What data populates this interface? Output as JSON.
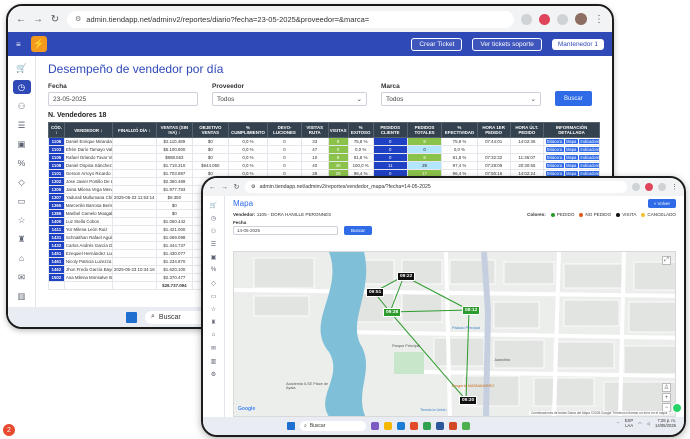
{
  "window1": {
    "url": "admin.tiendapp.net/adminv2/reportes/diario?fecha=23-05-2025&proveedor=&marca=",
    "top_buttons": {
      "ticket": "Crear Ticket",
      "support": "Ver tickets soporte",
      "user": "Mantenedor 1"
    },
    "title": "Desempeño de vendedor por día",
    "filters": {
      "fecha_label": "Fecha",
      "fecha_value": "23-05-2025",
      "proveedor_label": "Proveedor",
      "proveedor_value": "Todos",
      "marca_label": "Marca",
      "marca_value": "Todos",
      "search_button": "Buscar"
    },
    "table_title": "N. Vendedores 18",
    "columns": [
      "CÓD. ↕",
      "VENDEDOR ↕",
      "FINALIZÓ DÍA ↕",
      "VENTAS (SIN IVA) ↕",
      "OBJETIVO VENTAS",
      "% CUMPLIMIENTO",
      "DEVO-LUCIONES",
      "VISITAS RUTA",
      "VISITAS",
      "% EXITOSO",
      "PEDIDOS CLIENTE",
      "PEDIDOS TOTALES",
      "% EFECTIVIDAD",
      "HORA 1ER PEDIDO",
      "HORA ÚLT. PEDIDO",
      "INFORMACIÓN DETALLADA"
    ],
    "rows": [
      [
        "1106",
        "Daniel Enrique Miranda C...",
        "",
        "$2.110.489",
        "$0",
        "0,0 %",
        "0",
        "33",
        "6",
        "75,8 %",
        "0",
        "8",
        "75,8 %",
        "07:44:01",
        "14:02:36"
      ],
      [
        "1103",
        "Efrén Darío Tamayo Vale...",
        "",
        "$5.100.800",
        "$0",
        "0,0 %",
        "0",
        "47",
        "0",
        "0,0 %",
        "0",
        "0",
        "0,0 %",
        "",
        "",
        ""
      ],
      [
        "1105",
        "Rafael Orlando Tovar Vil...",
        "",
        "$888.553",
        "$0",
        "0,0 %",
        "0",
        "10",
        "8",
        "81,8 %",
        "0",
        "8",
        "81,8 %",
        "07:32:32",
        "11:36:07"
      ],
      [
        "1108",
        "Daniel Ospina Sánchez Amil...",
        "",
        "$1.719.310",
        "$644.050",
        "0,0 %",
        "0",
        "40",
        "40",
        "100,0 %",
        "11",
        "29",
        "97,4 %",
        "07:28:09",
        "20:30:55"
      ],
      [
        "1101",
        "Gerson Arroyo Ricardo H...",
        "",
        "$1.703.897",
        "$0",
        "0,0 %",
        "0",
        "28",
        "28",
        "96,4 %",
        "0",
        "17",
        "96,4 %",
        "07:50:16",
        "14:02:24"
      ],
      [
        "1302",
        "Jose Javier Portillo De Lo...",
        "",
        "$2.350.489",
        "",
        "",
        "",
        "",
        "",
        "",
        "",
        "",
        "",
        "",
        "",
        ""
      ],
      [
        "1305",
        "Jaina Milena Vega Mena...",
        "",
        "$1.977.783",
        "",
        "",
        "",
        "",
        "",
        "",
        "",
        "",
        "",
        "",
        "",
        ""
      ],
      [
        "1307",
        "Yadurali Mullumana Chiril F...",
        "2025-05-23 11:53:14",
        "$8.350",
        "",
        "",
        "",
        "",
        "",
        "",
        "",
        "",
        "",
        "",
        "",
        ""
      ],
      [
        "1365",
        "Marcenlin Barrosa Beriselo...",
        "",
        "$0",
        "",
        "",
        "",
        "",
        "",
        "",
        "",
        "",
        "",
        "",
        "",
        ""
      ],
      [
        "1386",
        "Maribel Camelo Moagal...",
        "",
        "$0",
        "",
        "",
        "",
        "",
        "",
        "",
        "",
        "",
        "",
        "",
        "",
        ""
      ],
      [
        "1400",
        "Luz Stella Cobos",
        "",
        "$1.050.442",
        "",
        "",
        "",
        "",
        "",
        "",
        "",
        "",
        "",
        "",
        "",
        ""
      ],
      [
        "1411",
        "Yor Milena León Ruiz",
        "",
        "$1.421.000",
        "",
        "",
        "",
        "",
        "",
        "",
        "",
        "",
        "",
        "",
        "",
        ""
      ],
      [
        "1431",
        "Schnaithan Rafael Aguilar...",
        "",
        "$1.069.098",
        "",
        "",
        "",
        "",
        "",
        "",
        "",
        "",
        "",
        "",
        "",
        ""
      ],
      [
        "1432",
        "Carlos Andrés García Dur...",
        "",
        "$1.344.737",
        "",
        "",
        "",
        "",
        "",
        "",
        "",
        "",
        "",
        "",
        "",
        ""
      ],
      [
        "1451",
        "Ezequiel Hernández Lune",
        "",
        "$1.430.077",
        "",
        "",
        "",
        "",
        "",
        "",
        "",
        "",
        "",
        "",
        "",
        ""
      ],
      [
        "1461",
        "Nicoly Patricia Luzezza Bri...",
        "",
        "$1.234.870",
        "",
        "",
        "",
        "",
        "",
        "",
        "",
        "",
        "",
        "",
        "",
        ""
      ],
      [
        "1462",
        "Jhon Fredo García Bayona",
        "2025-05-23 10:34:16",
        "$1.620.100",
        "",
        "",
        "",
        "",
        "",
        "",
        "",
        "",
        "",
        "",
        "",
        ""
      ],
      [
        "1502",
        "Ana Milena Monsalve Blan...",
        "",
        "$2.370.477",
        "",
        "",
        "",
        "",
        "",
        "",
        "",
        "",
        "",
        "",
        "",
        ""
      ],
      [
        "",
        "",
        "",
        "$26.737.094",
        "",
        "",
        "",
        "",
        "",
        "",
        "",
        "",
        "",
        "",
        "",
        ""
      ]
    ],
    "row_actions": [
      "Bitácora",
      "Mapa",
      "Indicadores"
    ],
    "taskbar": {
      "search": "Buscar"
    },
    "notification_count": "2"
  },
  "window2": {
    "url": "admin.tiendapp.net/adminv2/reportes/vendedor_mapa/?fecha=14-05-2025",
    "title": "Mapa",
    "volver": "« Volver",
    "vendedor_label": "Vendedor:",
    "vendedor_value": "1105 - DORA HANILLE PERONNES",
    "legend_label": "Colores:",
    "legend": [
      {
        "label": "PEDIDO",
        "color": "#2e9b2e"
      },
      {
        "label": "NO PEDIDO",
        "color": "#e05a1b"
      },
      {
        "label": "VISITA",
        "color": "#111111"
      },
      {
        "label": "CANCELADO",
        "color": "#f1c232"
      }
    ],
    "fecha_label": "Fecha",
    "fecha_value": "14-05-2025",
    "search_button": "Buscar",
    "map_pins": [
      {
        "label": "09:22",
        "style": "black"
      },
      {
        "label": "09:51",
        "style": "black"
      },
      {
        "label": "09:38",
        "style": "green"
      },
      {
        "label": "08:12",
        "style": "green"
      },
      {
        "label": "09:30",
        "style": "black"
      }
    ],
    "map_labels": {
      "plaza": "Plaza Principal de Juanchito",
      "plaza2": "Parque Principal",
      "plaza_cat": "Palacio Principal",
      "acad": "Academia ILSE\nPlace de Ayala",
      "drogueria": "Drogería MASNAVARRO",
      "juanchito": "Juanchito",
      "tienda": "Tienda la Unión",
      "google": "Google",
      "attrib": "Combinaciones de teclas  Datos del Mapa ©2025 Google  Términos  Informar un error en el mapa"
    },
    "taskbar": {
      "search": "Buscar",
      "lang1": "ESP",
      "lang2": "LAA",
      "time": "7:28 p. m.",
      "date": "14/05/2025"
    }
  }
}
